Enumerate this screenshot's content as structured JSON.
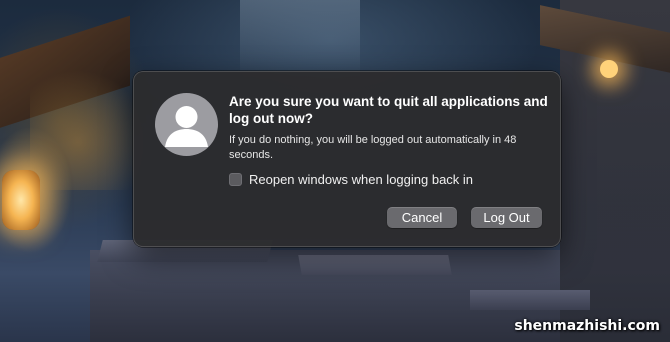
{
  "dialog": {
    "title": "Are you sure you want to quit all applications and log out now?",
    "message": "If you do nothing, you will be logged out automatically in 48 seconds.",
    "reopen_checkbox": {
      "label": "Reopen windows when logging back in",
      "checked": false
    },
    "buttons": {
      "cancel_label": "Cancel",
      "logout_label": "Log Out"
    },
    "avatar_icon": "user-silhouette-icon"
  },
  "watermark": "shenmazhishi.com",
  "colors": {
    "dialog_background": "#2c2c2e",
    "button_background": "#6a6a6e",
    "avatar_background": "#9c9ca1",
    "text_primary": "#ffffff"
  }
}
